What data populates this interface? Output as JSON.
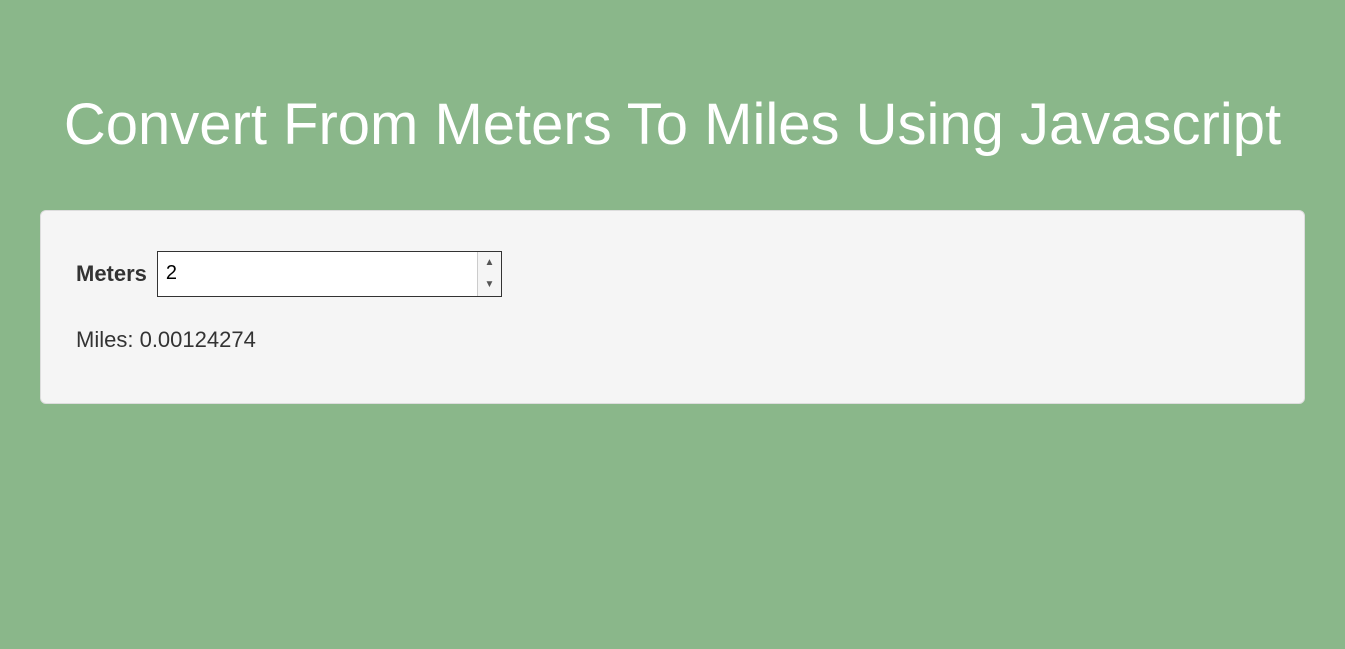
{
  "title": "Convert From Meters To Miles Using Javascript",
  "form": {
    "meters_label": "Meters",
    "meters_value": "2",
    "miles_label": "Miles:",
    "miles_value": "0.00124274"
  }
}
